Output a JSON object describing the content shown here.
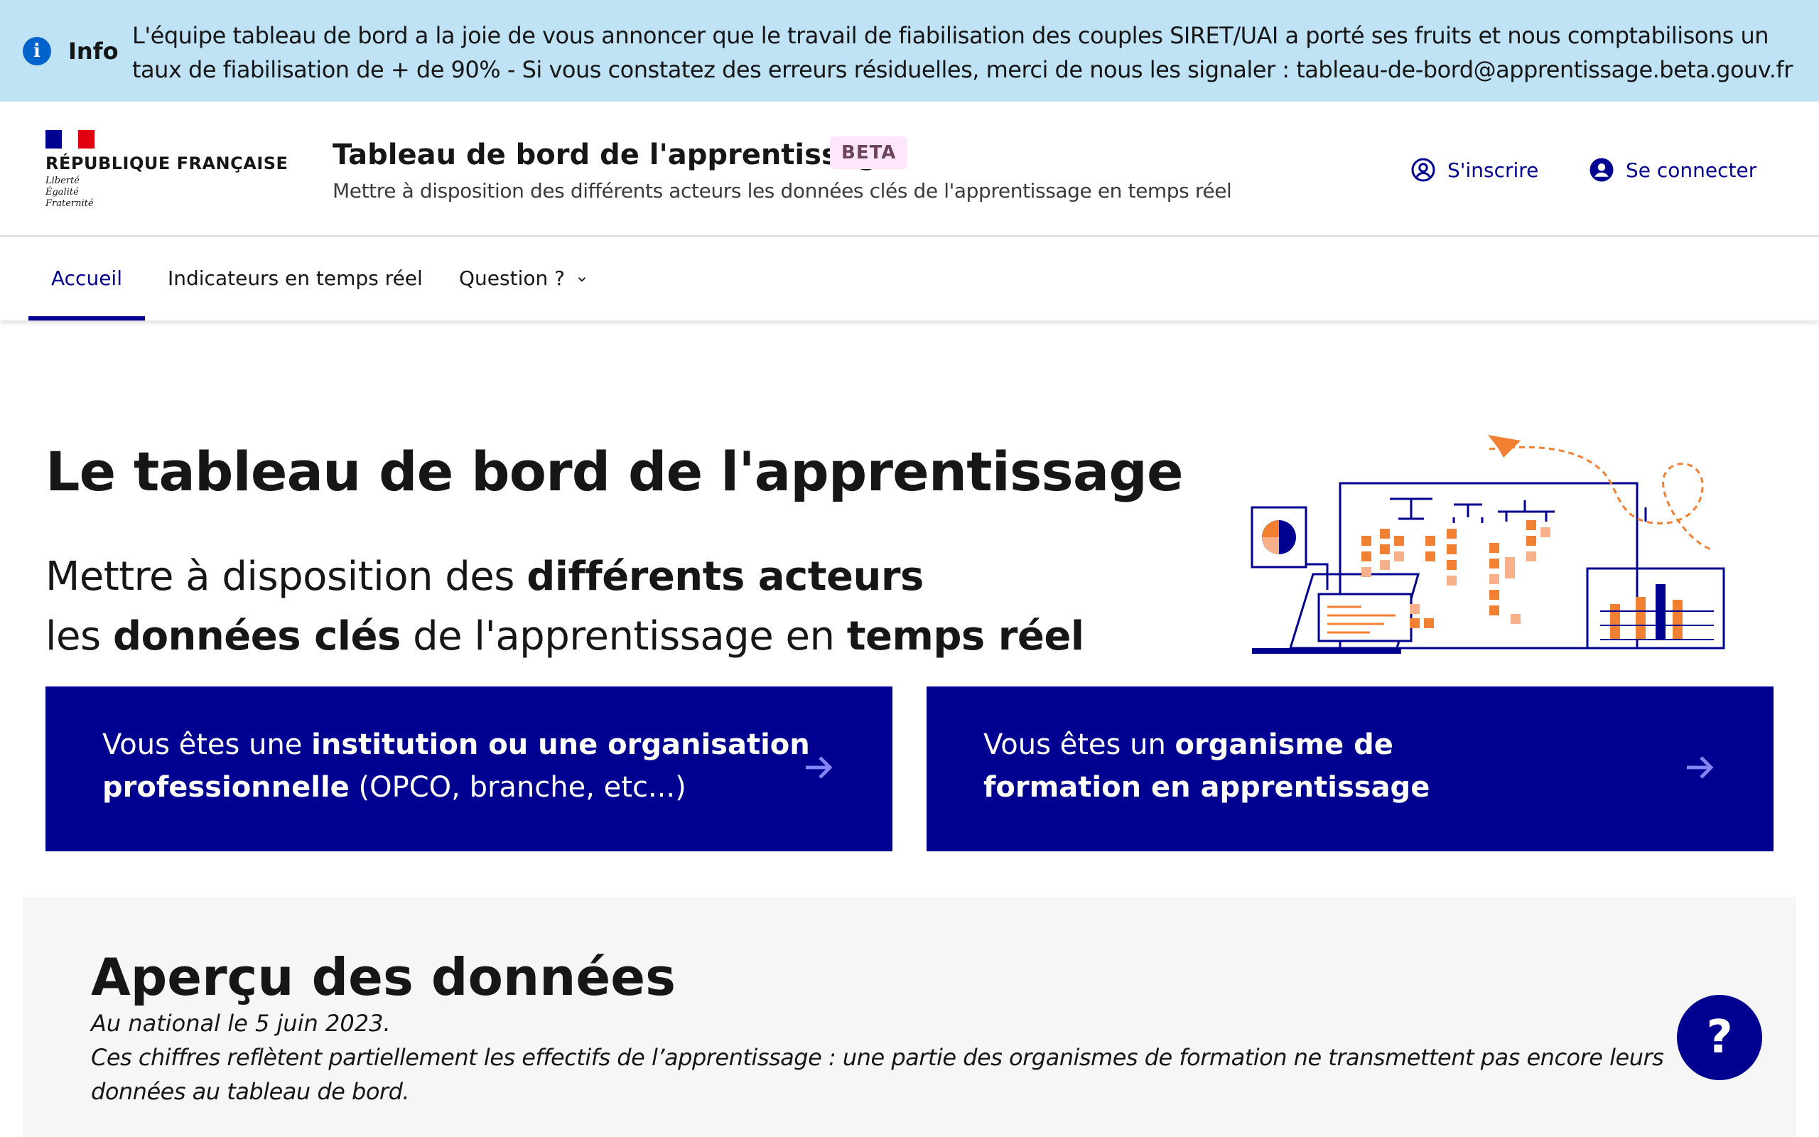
{
  "banner": {
    "title": "Info",
    "icon": "info-icon",
    "text": "L'équipe tableau de bord a la joie de vous annoncer que le travail de fiabilisation des couples SIRET/UAI a porté ses fruits et nous comptabilisons un taux de fiabilisation de + de 90% - Si vous constatez des erreurs résiduelles, merci de nous les signaler : tableau-de-bord@apprentissage.beta.gouv.fr"
  },
  "header": {
    "republic": "RÉPUBLIQUE FRANÇAISE",
    "motto": [
      "Liberté",
      "Égalité",
      "Fraternité"
    ],
    "service_title": "Tableau de bord de l'apprentissage",
    "badge": "BETA",
    "tagline": "Mettre à disposition des différents acteurs les données clés de l'apprentissage en temps réel",
    "signup": "S'inscrire",
    "login": "Se connecter"
  },
  "nav": {
    "items": [
      {
        "label": "Accueil",
        "active": true
      },
      {
        "label": "Indicateurs en temps réel",
        "active": false
      },
      {
        "label": "Question ?",
        "active": false
      }
    ]
  },
  "hero": {
    "title": "Le tableau de bord de l'apprentissage",
    "line1_a": "Mettre à disposition des ",
    "line1_b": "différents acteurs",
    "line2_a": "les ",
    "line2_b": "données clés",
    "line2_c": " de l'apprentissage en ",
    "line2_d": "temps réel"
  },
  "cta": {
    "institution": {
      "a": "Vous êtes une ",
      "b": "institution ou une organisation professionnelle",
      "c": " (OPCO, branche, etc...)"
    },
    "organisme": {
      "a": "Vous êtes un ",
      "b": "organisme de formation en apprentissage"
    }
  },
  "preview": {
    "title": "Aperçu des données",
    "date": "Au national le 5 juin 2023.",
    "note": "Ces chiffres reflètent partiellement les effectifs de l’apprentissage : une partie des organismes de formation ne transmettent pas encore leurs données au tableau de bord."
  },
  "help": {
    "label": "?"
  },
  "colors": {
    "primary": "#000091",
    "banner_bg": "#bfe2f5",
    "badge_bg": "#fee7fc",
    "accent": "#f28033",
    "flag_red": "#e1000f"
  }
}
